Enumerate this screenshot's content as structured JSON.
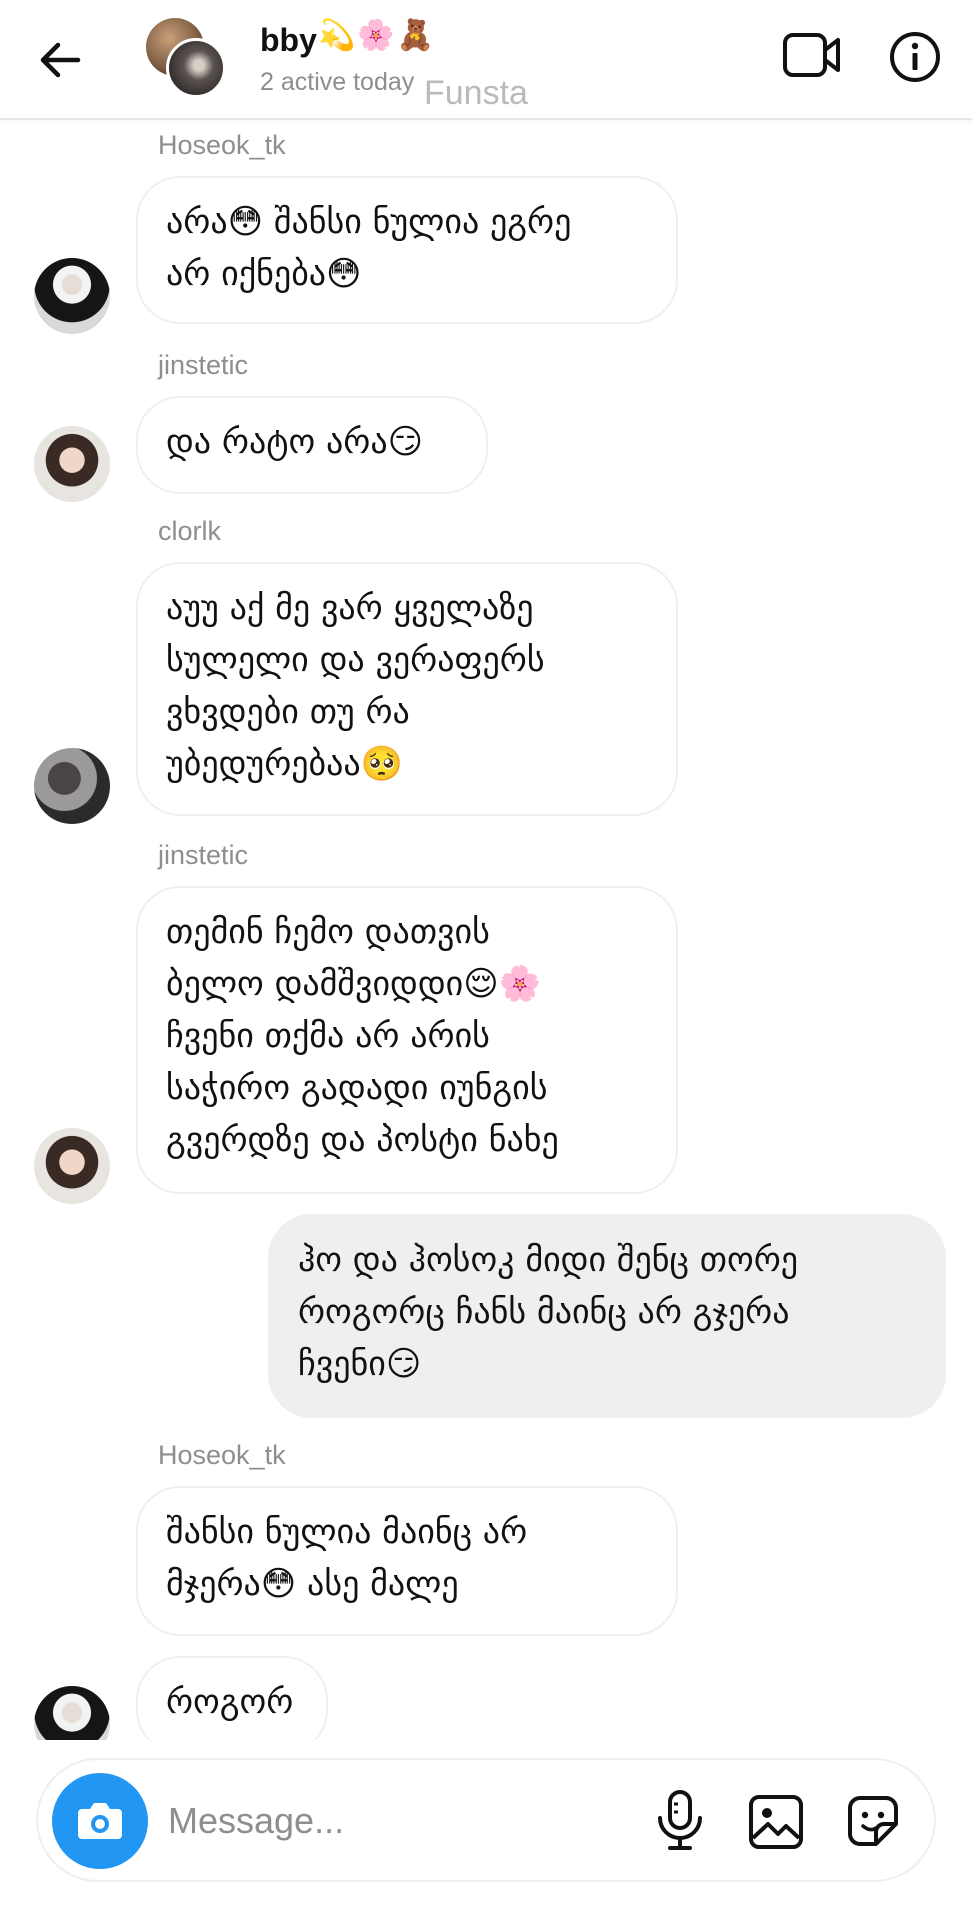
{
  "header": {
    "name": "bby",
    "name_emoji": "💫🌸🧸",
    "subtitle": "2 active today",
    "watermark": "Funsta"
  },
  "messages": [
    {
      "sender": "Hoseok_tk",
      "text": "არა😳 შანსი ნულია ეგრე\nარ იქნება😳"
    },
    {
      "sender": "jinstetic",
      "text": "და რატო არა😏"
    },
    {
      "sender": "clorlk",
      "text": "აუუ აქ მე ვარ ყველაზე\nსულელი და ვერაფერს\nვხვდები თუ რა\nუბედურებაა🥺"
    },
    {
      "sender": "jinstetic",
      "text": "თემინ ჩემო დათვის\nბელო დამშვიდდი😌🌸\nჩვენი თქმა არ არის\nსაჭირო გადადი იუნგის\nგვერდზე და პოსტი ნახე"
    },
    {
      "sender": "",
      "text": "ჰო და ჰოსოკ მიდი შენც თორე\nროგორც ჩანს მაინც არ გჯერა\nჩვენი😏"
    },
    {
      "sender": "Hoseok_tk",
      "text": "შანსი ნულია მაინც არ\nმჯერა😳 ასე მალე"
    },
    {
      "sender": "",
      "text": "როგორ"
    }
  ],
  "composer": {
    "placeholder": "Message..."
  },
  "colors": {
    "accent": "#2196f3",
    "own_bubble": "#efeef0",
    "secondary_text": "#8e8e8e"
  },
  "icons": [
    "back-arrow-icon",
    "video-camera-icon",
    "info-icon",
    "camera-icon",
    "microphone-icon",
    "gallery-icon",
    "sticker-icon"
  ]
}
